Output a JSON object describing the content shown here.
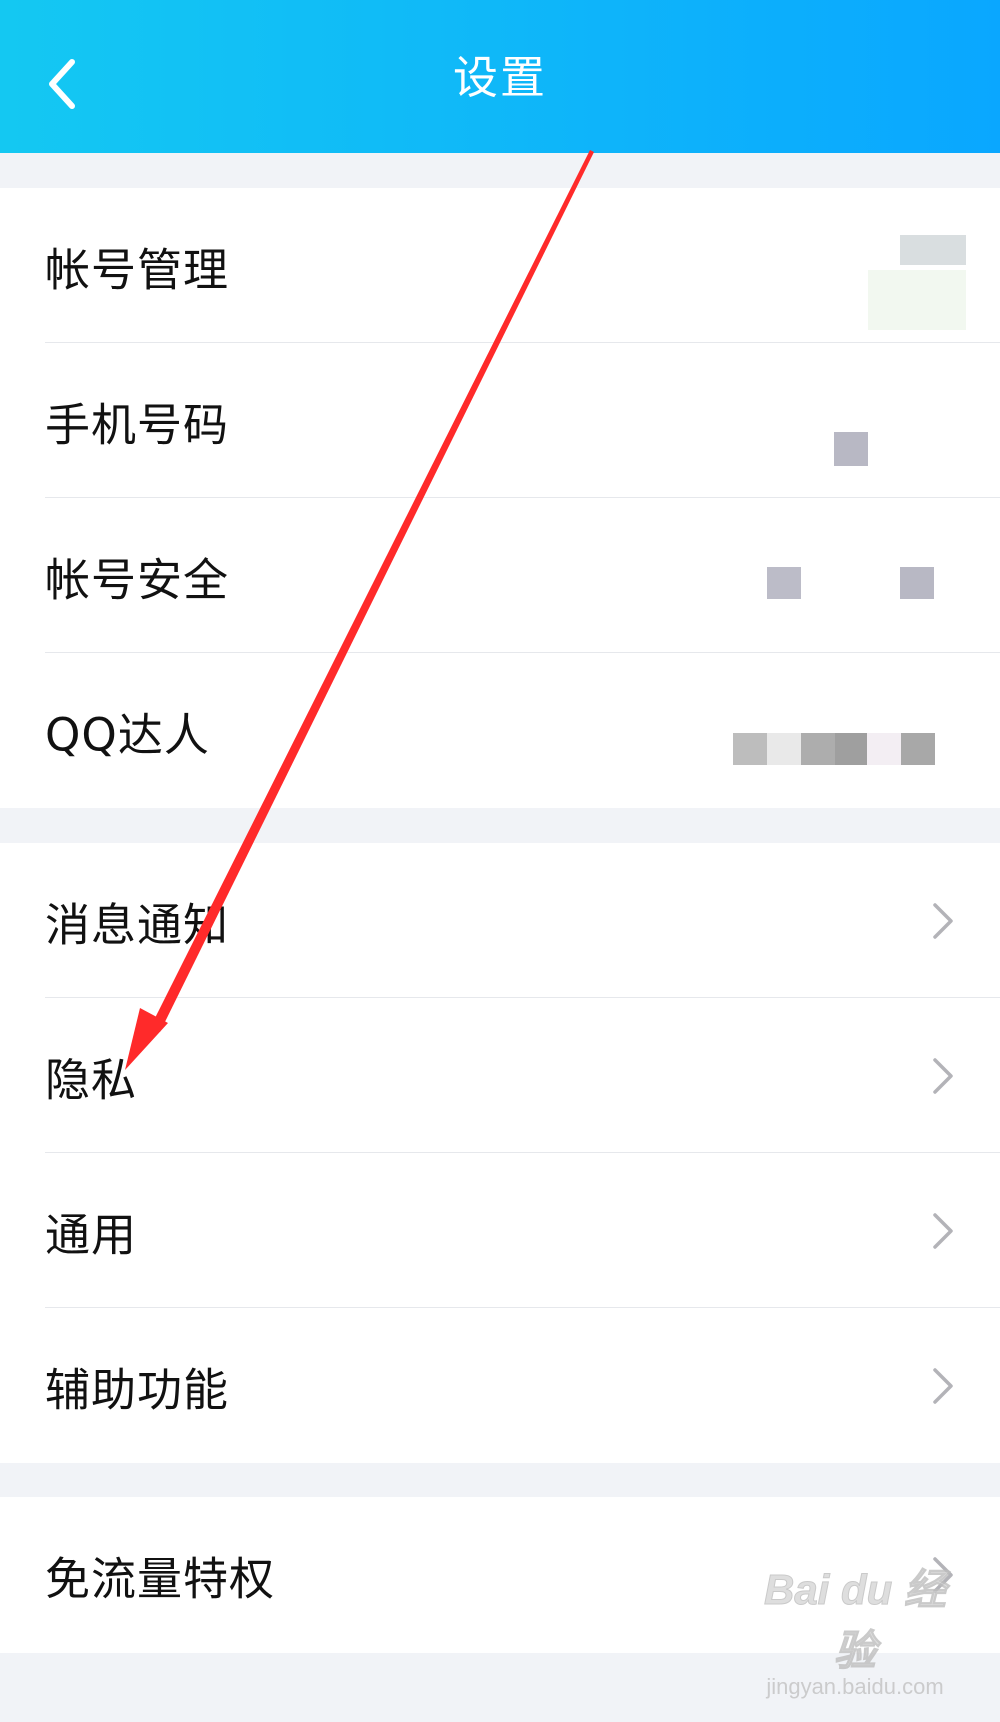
{
  "header": {
    "title": "设置",
    "back_icon": "chevron-left-icon"
  },
  "groups": [
    {
      "items": [
        {
          "label": "帐号管理",
          "chevron": false
        },
        {
          "label": "手机号码",
          "chevron": false
        },
        {
          "label": "帐号安全",
          "chevron": false
        },
        {
          "label": "QQ达人",
          "chevron": false
        }
      ]
    },
    {
      "items": [
        {
          "label": "消息通知",
          "chevron": true
        },
        {
          "label": "隐私",
          "chevron": true
        },
        {
          "label": "通用",
          "chevron": true
        },
        {
          "label": "辅助功能",
          "chevron": true
        }
      ]
    },
    {
      "items": [
        {
          "label": "免流量特权",
          "chevron": true
        }
      ]
    }
  ],
  "colors": {
    "header_start": "#14c8f2",
    "header_end": "#0aa7ff",
    "annotation_arrow": "#ff2a2a",
    "mosaic": "#b8b8c2"
  },
  "annotation": {
    "arrow_icon": "red-arrow-pointing-to-privacy"
  },
  "watermark": {
    "logo": "Bai du 经验",
    "url": "jingyan.baidu.com"
  }
}
